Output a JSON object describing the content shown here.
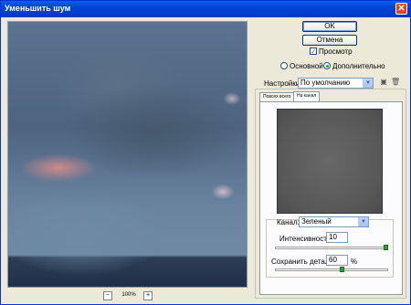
{
  "window": {
    "title": "Уменьшить шум",
    "close_glyph": "✕"
  },
  "preview": {
    "zoom_label": "100%",
    "zoom_out": "−",
    "zoom_in": "+"
  },
  "buttons": {
    "ok": "OK",
    "cancel": "Отмена"
  },
  "preview_toggle": {
    "label": "Просмотр",
    "checked": true,
    "mark": "✓"
  },
  "mode": {
    "basic_label": "Основной",
    "advanced_label": "Дополнительно",
    "selected": "advanced"
  },
  "settings": {
    "label": "Настройки:",
    "value": "По умолчанию",
    "save_glyph": "▣",
    "delete_glyph": "🗑"
  },
  "tabs": [
    {
      "label": "Повсех всего"
    },
    {
      "label": "На канал"
    }
  ],
  "active_tab": 1,
  "channel": {
    "label": "Канал:",
    "value": "Зеленый",
    "intensity_label": "Интенсивность:",
    "intensity_value": "10",
    "detail_label": "Сохранить детали:",
    "detail_value": "60",
    "detail_unit": "%",
    "intensity_level": 1.0,
    "detail_level": 0.6
  },
  "colors": {
    "accent": "#0043d6",
    "slider": "#3a9a3a"
  }
}
